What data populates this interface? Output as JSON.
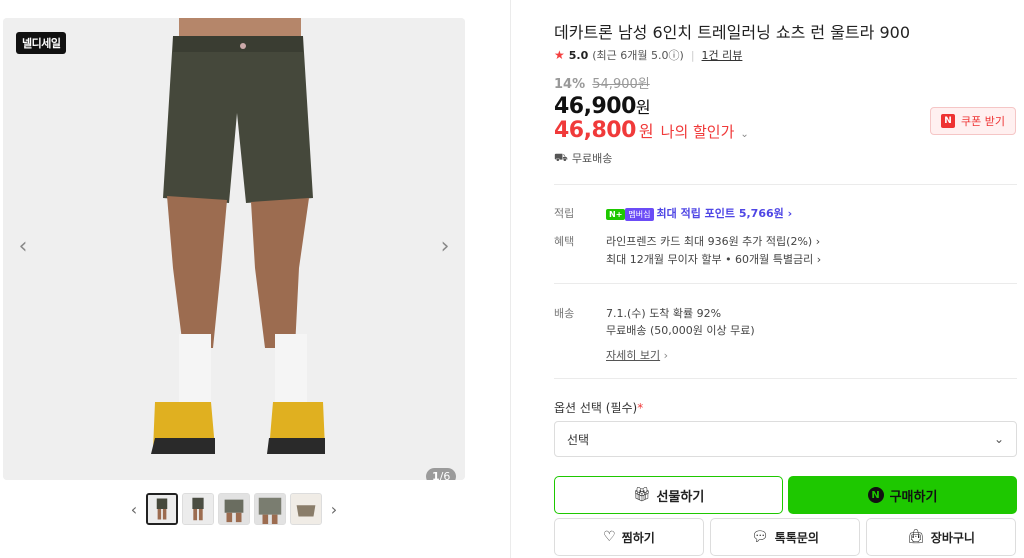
{
  "gallery": {
    "brand_badge": "넬디세일",
    "counter_current": "1",
    "counter_total": "/6",
    "prev_arrow": "‹",
    "next_arrow": "›",
    "thumb_count": 5
  },
  "product": {
    "title": "데카트론 남성 6인치 트레일러닝 쇼츠 런 울트라 900",
    "rating": "5.0",
    "rating_note": "(최근 6개월 5.0ⓘ)",
    "review_link": "1건 리뷰",
    "discount_rate": "14%",
    "original_price": "54,900원",
    "price": "46,900",
    "price_unit": "원",
    "my_price": "46,800",
    "my_price_unit": "원",
    "my_price_label": "나의 할인가",
    "coupon_label": "쿠폰 받기",
    "coupon_icon": "N",
    "free_shipping": "무료배송"
  },
  "benefits": {
    "points_label": "적립",
    "npay_badge": "N+",
    "npay_badge2": "멤버십",
    "points_text": "최대 적립 포인트 5,766원 ›",
    "benefit_label": "혜택",
    "benefit_line1": "라인프렌즈 카드 최대 936원 추가 적립(2%) ›",
    "benefit_line2": "최대 12개월 무이자 할부 • 60개월 특별금리 ›"
  },
  "delivery": {
    "label": "배송",
    "line1": "7.1.(수) 도착 확률 92%",
    "line2": "무료배송 (50,000원 이상 무료)",
    "detail_link": "자세히 보기",
    "detail_chev": "›"
  },
  "option": {
    "label": "옵션 선택 (필수)",
    "required_mark": "*",
    "select_value": "선택"
  },
  "actions": {
    "gift": "선물하기",
    "buy": "구매하기",
    "buy_icon": "N",
    "wish": "찜하기",
    "talk": "톡톡문의",
    "cart": "장바구니"
  },
  "colors": {
    "npay_green": "#1ec800",
    "sale_red": "#f03a3a",
    "point_purple": "#4f46e5"
  }
}
